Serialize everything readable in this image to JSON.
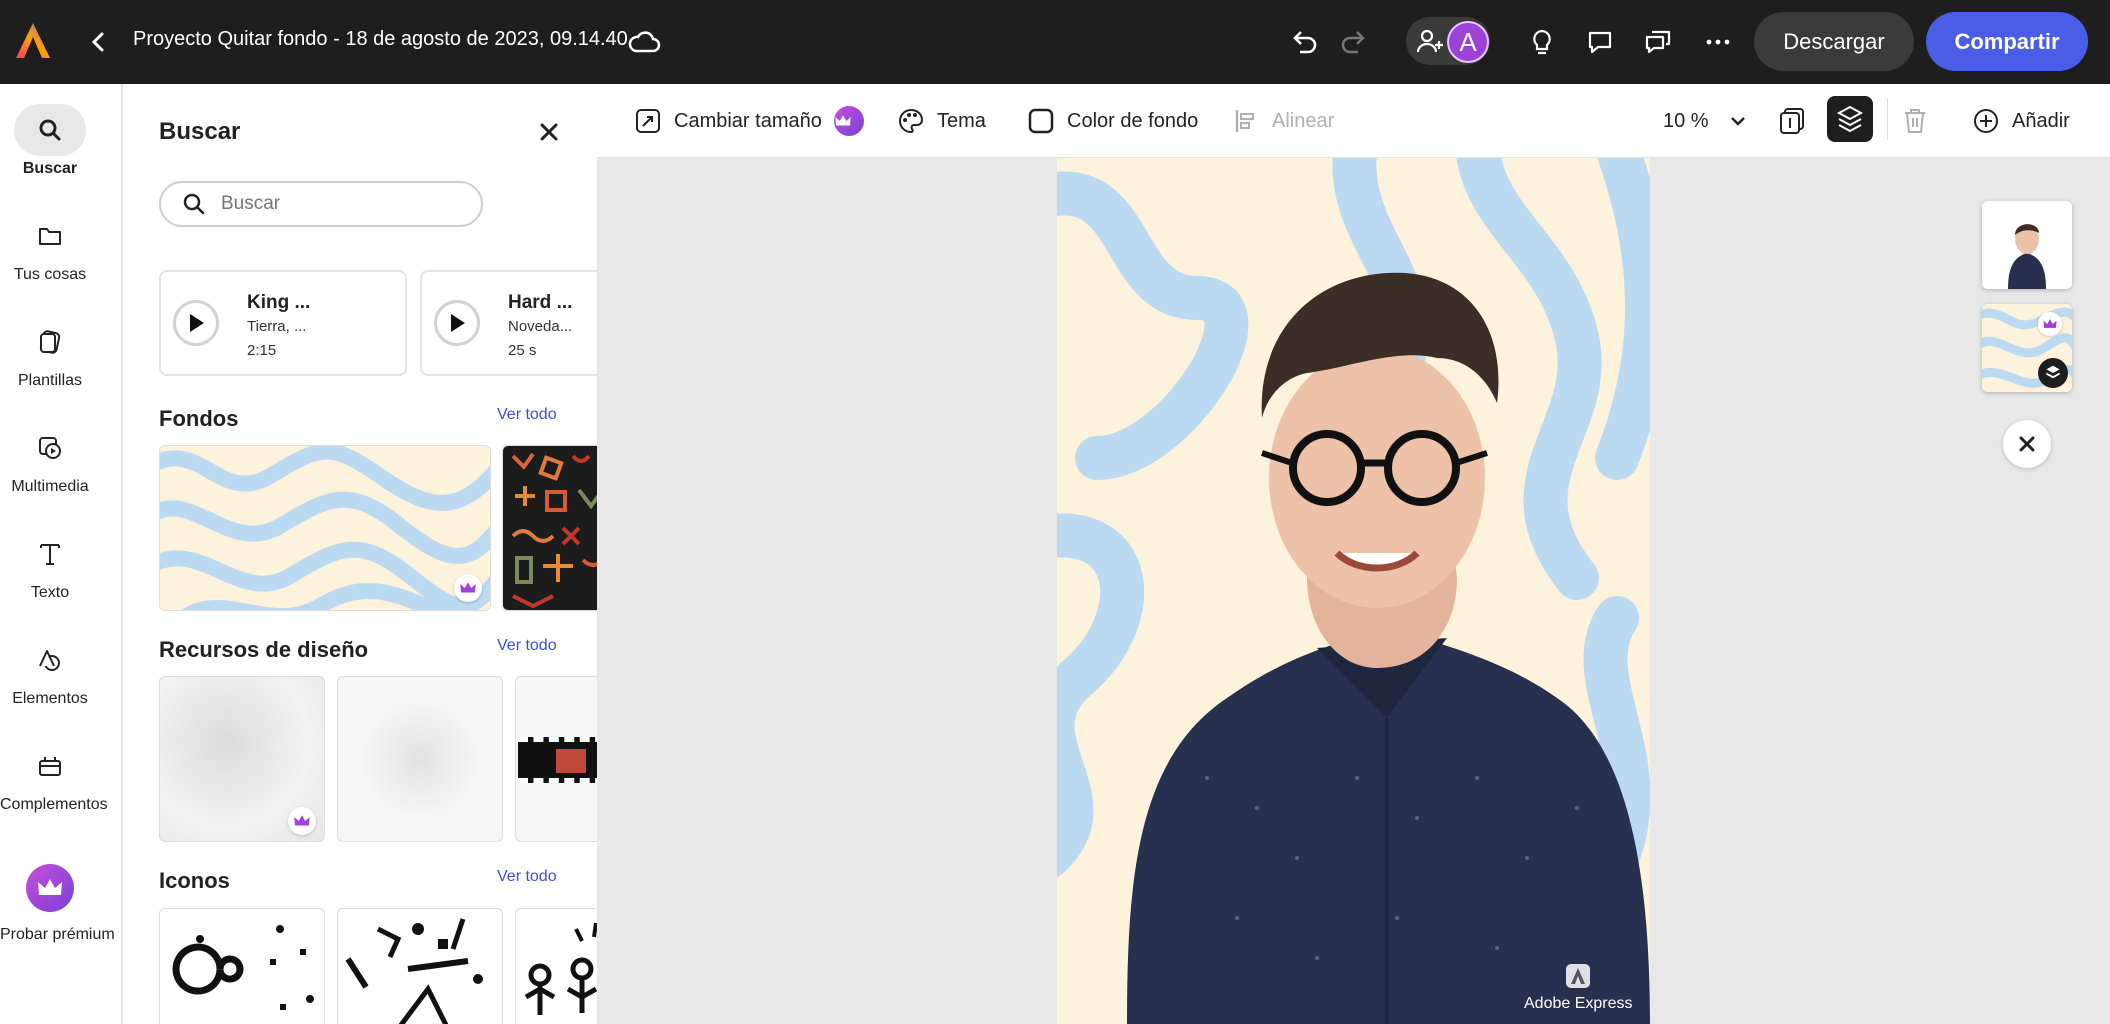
{
  "header": {
    "project_title": "Proyecto Quitar fondo - 18 de agosto de 2023, 09.14.40",
    "avatar_letter": "A",
    "download_label": "Descargar",
    "share_label": "Compartir",
    "share_color": "#4b5de6"
  },
  "rail": {
    "items": [
      {
        "label": "Buscar",
        "icon": "search-icon",
        "active": true
      },
      {
        "label": "Tus cosas",
        "icon": "folder-icon"
      },
      {
        "label": "Plantillas",
        "icon": "templates-icon"
      },
      {
        "label": "Multimedia",
        "icon": "media-icon"
      },
      {
        "label": "Texto",
        "icon": "text-icon"
      },
      {
        "label": "Elementos",
        "icon": "elements-icon"
      },
      {
        "label": "Complementos",
        "icon": "addons-icon"
      },
      {
        "label": "Probar prémium",
        "icon": "crown-icon"
      }
    ]
  },
  "panel": {
    "title": "Buscar",
    "search_placeholder": "Buscar",
    "music": [
      {
        "title": "King ...",
        "subtitle": "Tierra, ...",
        "duration": "2:15"
      },
      {
        "title": "Hard ...",
        "subtitle": "Noveda...",
        "duration": "25 s"
      }
    ],
    "sections": [
      {
        "title": "Fondos",
        "see_all": "Ver todo"
      },
      {
        "title": "Recursos de diseño",
        "see_all": "Ver todo"
      },
      {
        "title": "Iconos",
        "see_all": "Ver todo"
      }
    ]
  },
  "toolbar": {
    "resize": "Cambiar tamaño",
    "theme": "Tema",
    "bg_color": "Color de fondo",
    "align": "Alinear",
    "zoom": "10 %",
    "add": "Añadir"
  },
  "canvas": {
    "watermark": "Adobe Express",
    "bg_colors": [
      "#fdf3dc",
      "#bcd9f2"
    ]
  }
}
